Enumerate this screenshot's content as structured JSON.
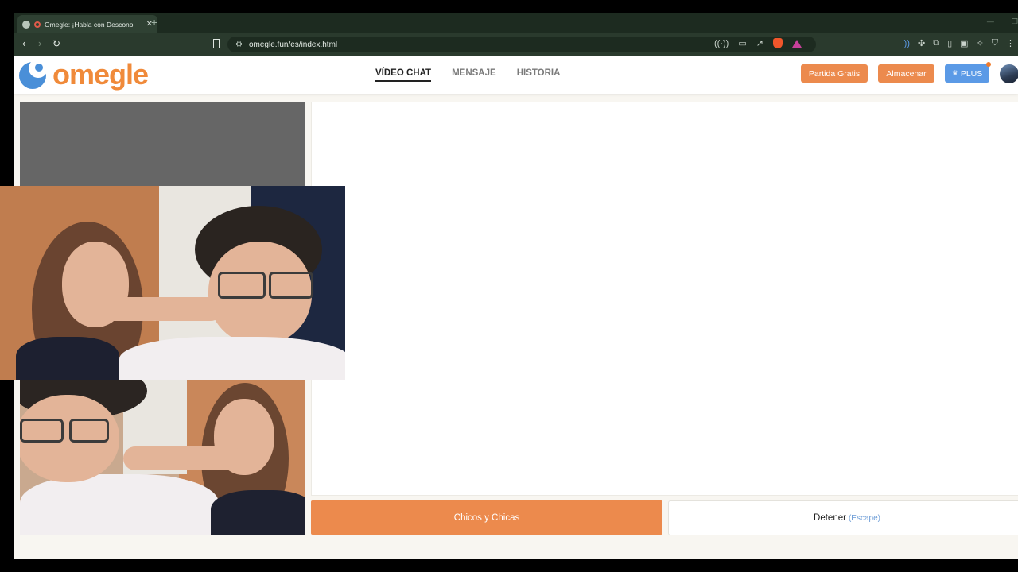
{
  "browser": {
    "tab_title": "Omegle: ¡Habla con Descono",
    "tab_close": "✕",
    "new_tab": "+",
    "url": "omegle.fun/es/index.html"
  },
  "header": {
    "logo_text": "omegle",
    "nav": {
      "video_chat": "VÍDEO CHAT",
      "mensaje": "MENSAJE",
      "historia": "HISTORIA"
    },
    "btn_partida": "Partida Gratis",
    "btn_almacenar": "Almacenar",
    "btn_plus": "PLUS",
    "plus_icon": "crown-icon"
  },
  "controls": {
    "start_label": "Chicos y Chicas",
    "stop_label": "Detener",
    "stop_hint": "(Escape)"
  },
  "colors": {
    "accent_orange": "#ec8a4d",
    "plus_blue": "#5b9ae6",
    "logo_blue": "#4a8fd8",
    "logo_orange": "#f08a3a"
  }
}
